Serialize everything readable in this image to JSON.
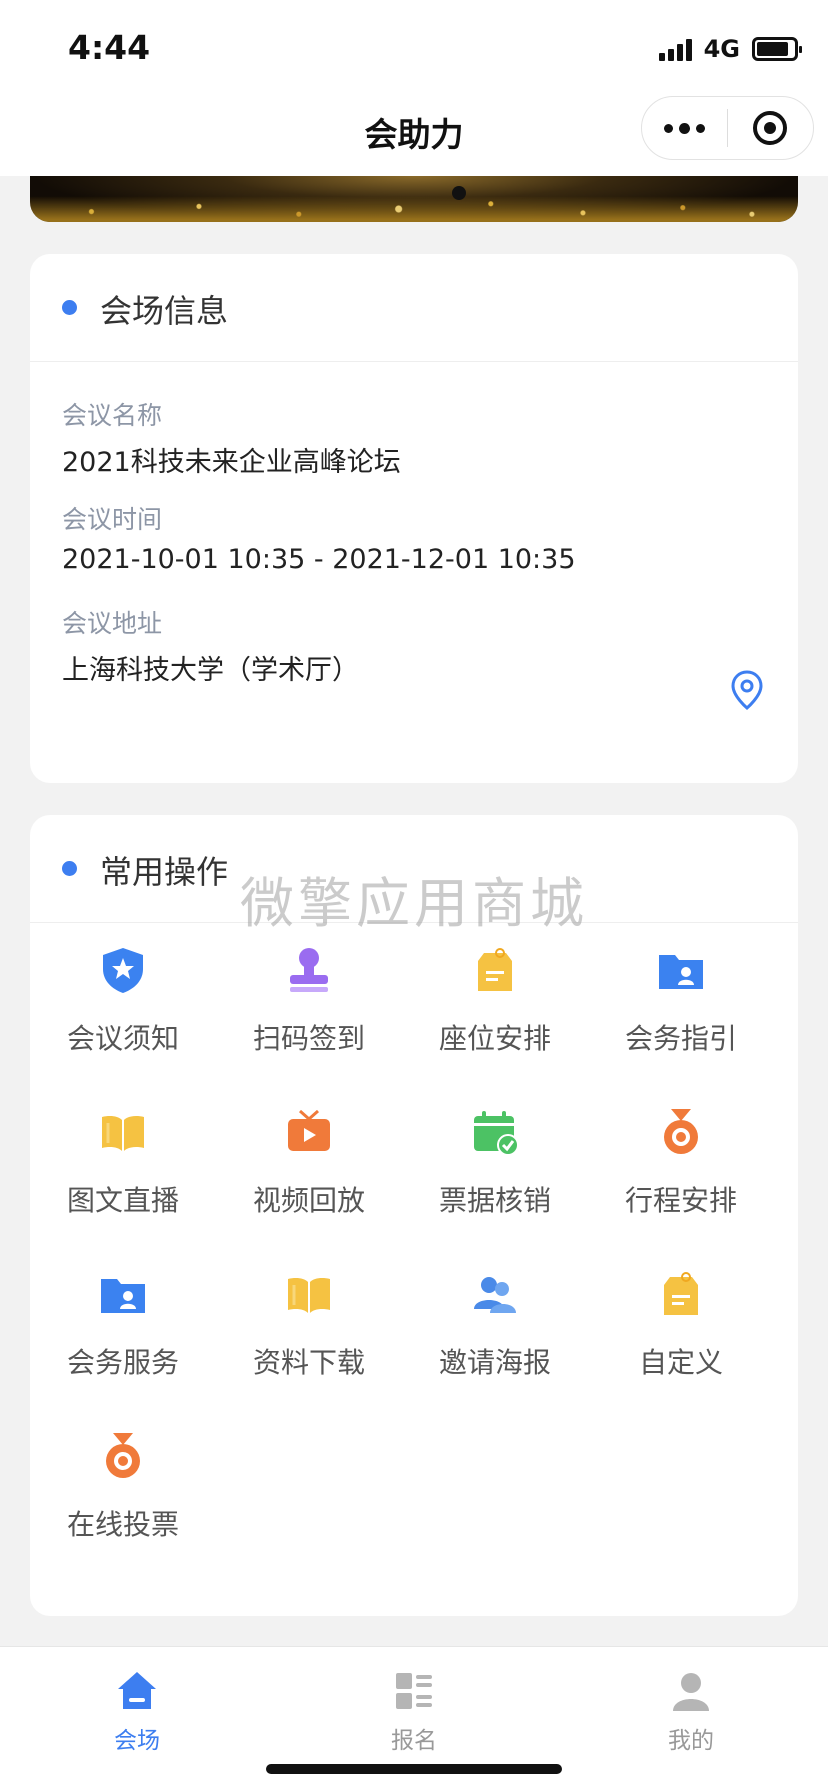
{
  "status_bar": {
    "time": "4:44",
    "network": "4G"
  },
  "nav": {
    "title": "会助力"
  },
  "venue_card": {
    "title": "会场信息",
    "fields": [
      {
        "label": "会议名称",
        "value": "2021科技未来企业高峰论坛"
      },
      {
        "label": "会议时间",
        "value": "2021-10-01 10:35 - 2021-12-01 10:35"
      },
      {
        "label": "会议地址",
        "value": "上海科技大学（学术厅）"
      }
    ]
  },
  "ops_card": {
    "title": "常用操作",
    "watermark": "微擎应用商城",
    "items": [
      {
        "label": "会议须知",
        "icon": "shield-star-icon",
        "color": "#3b82f0"
      },
      {
        "label": "扫码签到",
        "icon": "stamp-icon",
        "color": "#9a6cf0"
      },
      {
        "label": "座位安排",
        "icon": "tag-icon",
        "color": "#f5c242"
      },
      {
        "label": "会务指引",
        "icon": "folder-user-icon",
        "color": "#3b82f0"
      },
      {
        "label": "图文直播",
        "icon": "book-icon",
        "color": "#f5c242"
      },
      {
        "label": "视频回放",
        "icon": "tv-play-icon",
        "color": "#f07a3a"
      },
      {
        "label": "票据核销",
        "icon": "calendar-check-icon",
        "color": "#4cc264"
      },
      {
        "label": "行程安排",
        "icon": "medal-icon",
        "color": "#f07a3a"
      },
      {
        "label": "会务服务",
        "icon": "folder-user-icon",
        "color": "#3b82f0"
      },
      {
        "label": "资料下载",
        "icon": "book-icon",
        "color": "#f5c242"
      },
      {
        "label": "邀请海报",
        "icon": "users-icon",
        "color": "#4a8ae8"
      },
      {
        "label": "自定义",
        "icon": "tag-icon",
        "color": "#f5c242"
      },
      {
        "label": "在线投票",
        "icon": "medal-icon",
        "color": "#f07a3a"
      }
    ]
  },
  "tabs": [
    {
      "label": "会场",
      "icon": "home-icon",
      "active": true,
      "color": "#3d7ef0"
    },
    {
      "label": "报名",
      "icon": "grid-list-icon",
      "active": false,
      "color": "#b5b5b5"
    },
    {
      "label": "我的",
      "icon": "person-icon",
      "active": false,
      "color": "#b5b5b5"
    }
  ]
}
